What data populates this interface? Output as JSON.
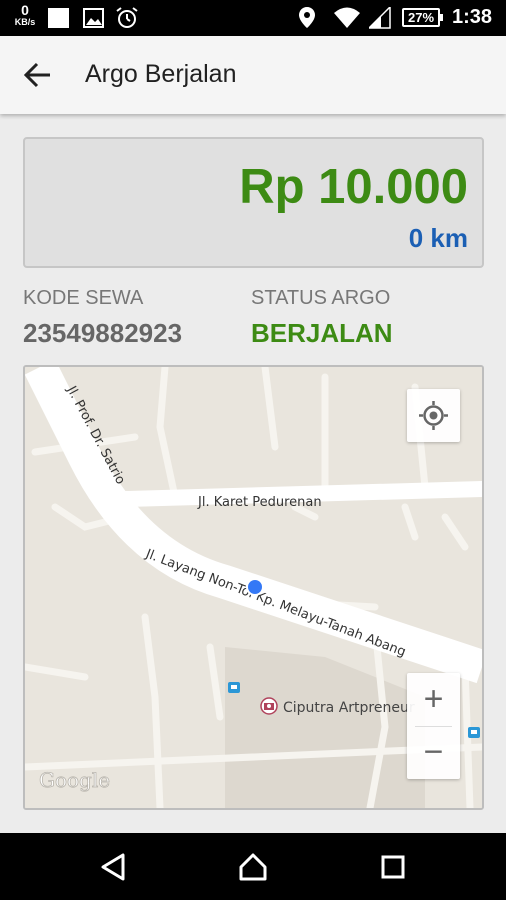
{
  "status_bar": {
    "net_speed_value": "0",
    "net_speed_unit": "KB/s",
    "battery": "27%",
    "time": "1:38",
    "icons": [
      "notification-square-icon",
      "image-icon",
      "alarm-icon",
      "location-pin-icon",
      "wifi-icon",
      "signal-icon",
      "battery-icon"
    ]
  },
  "app_bar": {
    "title": "Argo Berjalan",
    "back_icon": "arrow-back-icon"
  },
  "fare": {
    "amount": "Rp 10.000",
    "distance": "0 km",
    "amount_color": "#3d8b14",
    "distance_color": "#1b5fb4"
  },
  "info": {
    "kode_label": "KODE SEWA",
    "kode_value": "23549882923",
    "status_label": "STATUS ARGO",
    "status_value": "BERJALAN",
    "status_color": "#3d8b14"
  },
  "map": {
    "streets": {
      "prof_satrio": "Jl. Prof. Dr. Satrio",
      "karet_pedurenan": "Jl. Karet Pedurenan",
      "layang": "Jl. Layang Non-Tol Kp. Melayu-Tanah Abang"
    },
    "poi_label": "Ciputra Artpreneur",
    "attribution": "Google",
    "controls": {
      "zoom_in": "+",
      "zoom_out": "−",
      "my_location_icon": "crosshair-icon"
    }
  },
  "nav_bar": {
    "icons": [
      "back-triangle-icon",
      "home-icon",
      "recents-icon"
    ]
  }
}
